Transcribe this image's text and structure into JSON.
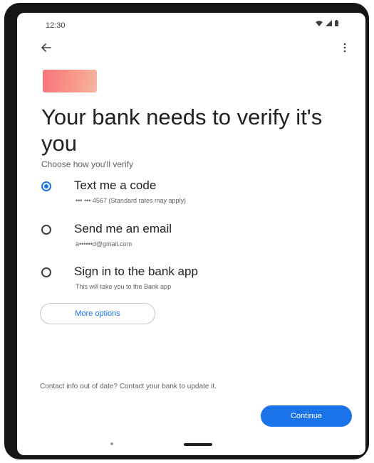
{
  "status_bar": {
    "time": "12:30",
    "icons": [
      "wifi-icon",
      "signal-icon",
      "battery-icon"
    ]
  },
  "top_bar": {
    "back_icon": "arrow-back-icon",
    "menu_icon": "more-vert-icon"
  },
  "header": {
    "title": "Your bank needs to verify it's you",
    "subtitle": "Choose how you'll verify"
  },
  "options": [
    {
      "label": "Text me a code",
      "description": "••• ••• 4567 (Standard rates may apply)",
      "selected": true
    },
    {
      "label": "Send me an email",
      "description": "a••••••d@gmail.com",
      "selected": false
    },
    {
      "label": "Sign in to the bank app",
      "description": "This will take you to the Bank app",
      "selected": false
    }
  ],
  "more_options_label": "More options",
  "footer_note": "Contact info out of date? Contact your bank to update it.",
  "continue_label": "Continue",
  "colors": {
    "accent": "#1a73e8",
    "card_gradient_start": "#f7747b",
    "card_gradient_end": "#f6b6a5",
    "frame": "#151515"
  }
}
